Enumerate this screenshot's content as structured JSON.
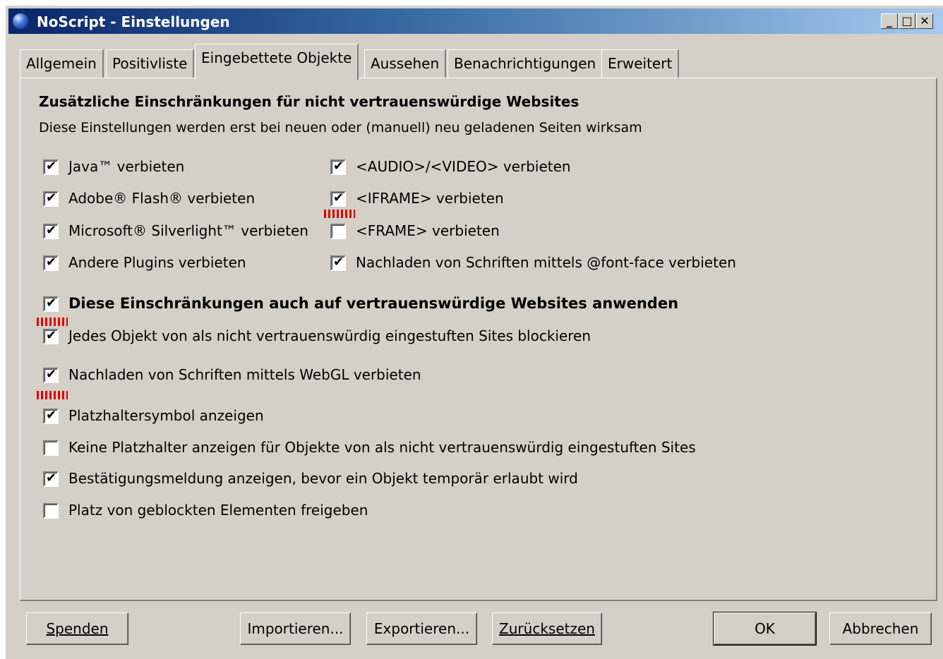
{
  "window": {
    "title": "NoScript - Einstellungen"
  },
  "titlebar_buttons": {
    "minimize": "_",
    "maximize": "□",
    "close": "✕"
  },
  "tabs": [
    {
      "label": "Allgemein",
      "active": false
    },
    {
      "label": "Positivliste",
      "active": false
    },
    {
      "label": "Eingebettete Objekte",
      "active": true
    },
    {
      "label": "Aussehen",
      "active": false
    },
    {
      "label": "Benachrichtigungen",
      "active": false
    },
    {
      "label": "Erweitert",
      "active": false
    }
  ],
  "panel": {
    "heading": "Zusätzliche Einschränkungen für nicht vertrauenswürdige Websites",
    "subheading": "Diese Einstellungen werden erst bei neuen oder (manuell) neu geladenen Seiten wirksam",
    "left_options": [
      {
        "label": "Java™ verbieten",
        "checked": true
      },
      {
        "label": "Adobe® Flash® verbieten",
        "checked": true
      },
      {
        "label": "Microsoft® Silverlight™ verbieten",
        "checked": true
      },
      {
        "label": "Andere Plugins verbieten",
        "checked": true
      }
    ],
    "right_options": [
      {
        "label": "<AUDIO>/<VIDEO> verbieten",
        "checked": true
      },
      {
        "label": "<IFRAME> verbieten",
        "checked": true
      },
      {
        "label": "<FRAME> verbieten",
        "checked": false
      },
      {
        "label": "Nachladen von Schriften mittels @font-face verbieten",
        "checked": true
      }
    ],
    "apply_trusted": {
      "label": "Diese Einschränkungen auch auf vertrauenswürdige Websites anwenden",
      "checked": true
    },
    "options": [
      {
        "label": "Jedes Objekt von als nicht vertrauenswürdig eingestuften Sites blockieren",
        "checked": true
      },
      {
        "label": "Nachladen von Schriften mittels WebGL verbieten",
        "checked": true
      },
      {
        "label": "Platzhaltersymbol anzeigen",
        "checked": true
      },
      {
        "label": "Keine Platzhalter anzeigen für Objekte von als nicht vertrauenswürdig eingestuften Sites",
        "checked": false
      },
      {
        "label": "Bestätigungsmeldung anzeigen, bevor ein Objekt temporär erlaubt wird",
        "checked": true
      },
      {
        "label": "Platz von geblockten Elementen freigeben",
        "checked": false
      }
    ]
  },
  "buttons": {
    "donate": "Spenden",
    "import": "Importieren...",
    "export": "Exportieren...",
    "reset": "Zurücksetzen",
    "ok": "OK",
    "cancel": "Abbrechen"
  },
  "check_glyph": "✔",
  "colors": {
    "face": "#d4d0c8",
    "title_start": "#0a246a",
    "title_end": "#a6caf0",
    "annotation": "#e00000"
  }
}
